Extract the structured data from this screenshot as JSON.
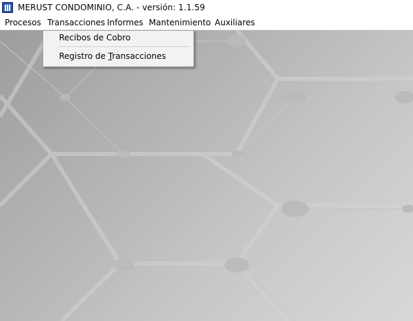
{
  "window": {
    "title": "MERUST CONDOMINIO, C.A. - versión: 1.1.59",
    "icon": "app-window-icon"
  },
  "menubar": {
    "items": [
      {
        "label": "Procesos"
      },
      {
        "label": "Transacciones"
      },
      {
        "label": "Informes"
      },
      {
        "label": "Mantenimiento"
      },
      {
        "label": "Auxiliares"
      }
    ],
    "open_menu": "Transacciones"
  },
  "dropdown": {
    "items": [
      {
        "label": "Recibos de Cobro"
      },
      {
        "label_before": "Registro de ",
        "label_accel": "T",
        "label_after": "ransacciones"
      }
    ]
  },
  "colors": {
    "workspace_dark": "#9d9d9d",
    "workspace_light": "#d8d8d8",
    "menu_bg": "#f2f2f2",
    "title_icon": "#1a3a7a"
  }
}
